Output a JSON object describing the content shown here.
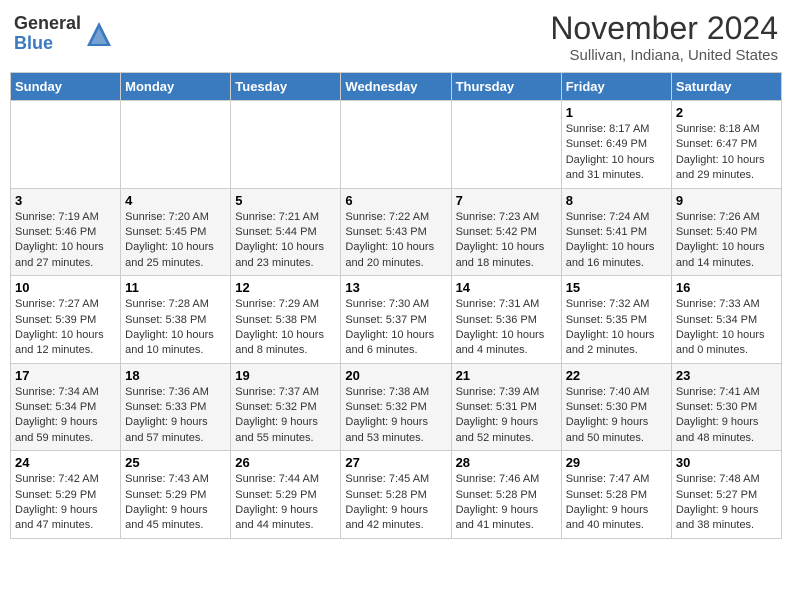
{
  "header": {
    "logo_general": "General",
    "logo_blue": "Blue",
    "month_title": "November 2024",
    "location": "Sullivan, Indiana, United States"
  },
  "weekdays": [
    "Sunday",
    "Monday",
    "Tuesday",
    "Wednesday",
    "Thursday",
    "Friday",
    "Saturday"
  ],
  "weeks": [
    [
      {
        "day": "",
        "info": ""
      },
      {
        "day": "",
        "info": ""
      },
      {
        "day": "",
        "info": ""
      },
      {
        "day": "",
        "info": ""
      },
      {
        "day": "",
        "info": ""
      },
      {
        "day": "1",
        "info": "Sunrise: 8:17 AM\nSunset: 6:49 PM\nDaylight: 10 hours and 31 minutes."
      },
      {
        "day": "2",
        "info": "Sunrise: 8:18 AM\nSunset: 6:47 PM\nDaylight: 10 hours and 29 minutes."
      }
    ],
    [
      {
        "day": "3",
        "info": "Sunrise: 7:19 AM\nSunset: 5:46 PM\nDaylight: 10 hours and 27 minutes."
      },
      {
        "day": "4",
        "info": "Sunrise: 7:20 AM\nSunset: 5:45 PM\nDaylight: 10 hours and 25 minutes."
      },
      {
        "day": "5",
        "info": "Sunrise: 7:21 AM\nSunset: 5:44 PM\nDaylight: 10 hours and 23 minutes."
      },
      {
        "day": "6",
        "info": "Sunrise: 7:22 AM\nSunset: 5:43 PM\nDaylight: 10 hours and 20 minutes."
      },
      {
        "day": "7",
        "info": "Sunrise: 7:23 AM\nSunset: 5:42 PM\nDaylight: 10 hours and 18 minutes."
      },
      {
        "day": "8",
        "info": "Sunrise: 7:24 AM\nSunset: 5:41 PM\nDaylight: 10 hours and 16 minutes."
      },
      {
        "day": "9",
        "info": "Sunrise: 7:26 AM\nSunset: 5:40 PM\nDaylight: 10 hours and 14 minutes."
      }
    ],
    [
      {
        "day": "10",
        "info": "Sunrise: 7:27 AM\nSunset: 5:39 PM\nDaylight: 10 hours and 12 minutes."
      },
      {
        "day": "11",
        "info": "Sunrise: 7:28 AM\nSunset: 5:38 PM\nDaylight: 10 hours and 10 minutes."
      },
      {
        "day": "12",
        "info": "Sunrise: 7:29 AM\nSunset: 5:38 PM\nDaylight: 10 hours and 8 minutes."
      },
      {
        "day": "13",
        "info": "Sunrise: 7:30 AM\nSunset: 5:37 PM\nDaylight: 10 hours and 6 minutes."
      },
      {
        "day": "14",
        "info": "Sunrise: 7:31 AM\nSunset: 5:36 PM\nDaylight: 10 hours and 4 minutes."
      },
      {
        "day": "15",
        "info": "Sunrise: 7:32 AM\nSunset: 5:35 PM\nDaylight: 10 hours and 2 minutes."
      },
      {
        "day": "16",
        "info": "Sunrise: 7:33 AM\nSunset: 5:34 PM\nDaylight: 10 hours and 0 minutes."
      }
    ],
    [
      {
        "day": "17",
        "info": "Sunrise: 7:34 AM\nSunset: 5:34 PM\nDaylight: 9 hours and 59 minutes."
      },
      {
        "day": "18",
        "info": "Sunrise: 7:36 AM\nSunset: 5:33 PM\nDaylight: 9 hours and 57 minutes."
      },
      {
        "day": "19",
        "info": "Sunrise: 7:37 AM\nSunset: 5:32 PM\nDaylight: 9 hours and 55 minutes."
      },
      {
        "day": "20",
        "info": "Sunrise: 7:38 AM\nSunset: 5:32 PM\nDaylight: 9 hours and 53 minutes."
      },
      {
        "day": "21",
        "info": "Sunrise: 7:39 AM\nSunset: 5:31 PM\nDaylight: 9 hours and 52 minutes."
      },
      {
        "day": "22",
        "info": "Sunrise: 7:40 AM\nSunset: 5:30 PM\nDaylight: 9 hours and 50 minutes."
      },
      {
        "day": "23",
        "info": "Sunrise: 7:41 AM\nSunset: 5:30 PM\nDaylight: 9 hours and 48 minutes."
      }
    ],
    [
      {
        "day": "24",
        "info": "Sunrise: 7:42 AM\nSunset: 5:29 PM\nDaylight: 9 hours and 47 minutes."
      },
      {
        "day": "25",
        "info": "Sunrise: 7:43 AM\nSunset: 5:29 PM\nDaylight: 9 hours and 45 minutes."
      },
      {
        "day": "26",
        "info": "Sunrise: 7:44 AM\nSunset: 5:29 PM\nDaylight: 9 hours and 44 minutes."
      },
      {
        "day": "27",
        "info": "Sunrise: 7:45 AM\nSunset: 5:28 PM\nDaylight: 9 hours and 42 minutes."
      },
      {
        "day": "28",
        "info": "Sunrise: 7:46 AM\nSunset: 5:28 PM\nDaylight: 9 hours and 41 minutes."
      },
      {
        "day": "29",
        "info": "Sunrise: 7:47 AM\nSunset: 5:28 PM\nDaylight: 9 hours and 40 minutes."
      },
      {
        "day": "30",
        "info": "Sunrise: 7:48 AM\nSunset: 5:27 PM\nDaylight: 9 hours and 38 minutes."
      }
    ]
  ]
}
